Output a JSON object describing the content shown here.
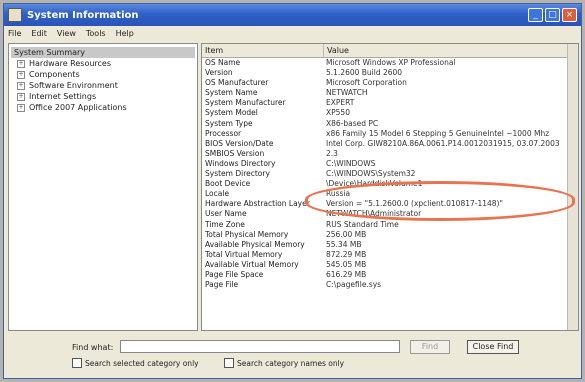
{
  "window": {
    "title": "System Information"
  },
  "menu": [
    "File",
    "Edit",
    "View",
    "Tools",
    "Help"
  ],
  "tree": {
    "root": "System Summary",
    "children": [
      "Hardware Resources",
      "Components",
      "Software Environment",
      "Internet Settings",
      "Office 2007 Applications"
    ]
  },
  "columns": {
    "item": "Item",
    "value": "Value"
  },
  "rows": [
    {
      "item": "OS Name",
      "value": "Microsoft Windows XP Professional"
    },
    {
      "item": "Version",
      "value": "5.1.2600 Build 2600"
    },
    {
      "item": "OS Manufacturer",
      "value": "Microsoft Corporation"
    },
    {
      "item": "System Name",
      "value": "NETWATCH"
    },
    {
      "item": "System Manufacturer",
      "value": "EXPERT"
    },
    {
      "item": "System Model",
      "value": "XP550"
    },
    {
      "item": "System Type",
      "value": "X86-based PC"
    },
    {
      "item": "Processor",
      "value": "x86 Family 15 Model 6 Stepping 5 GenuineIntel ~1000 Mhz"
    },
    {
      "item": "BIOS Version/Date",
      "value": "Intel Corp. GIW8210A.86A.0061.P14.0012031915, 03.07.2003"
    },
    {
      "item": "SMBIOS Version",
      "value": "2.3"
    },
    {
      "item": "Windows Directory",
      "value": "C:\\WINDOWS"
    },
    {
      "item": "System Directory",
      "value": "C:\\WINDOWS\\System32"
    },
    {
      "item": "Boot Device",
      "value": "\\Device\\HarddiskVolume1"
    },
    {
      "item": "Locale",
      "value": "Russia"
    },
    {
      "item": "Hardware Abstraction Layer",
      "value": "Version = \"5.1.2600.0 (xpclient.010817-1148)\""
    },
    {
      "item": "User Name",
      "value": "NETWATCH\\Administrator"
    },
    {
      "item": "Time Zone",
      "value": "RUS Standard Time"
    },
    {
      "item": "Total Physical Memory",
      "value": "256.00 MB"
    },
    {
      "item": "Available Physical Memory",
      "value": "55.34 MB"
    },
    {
      "item": "Total Virtual Memory",
      "value": "872.29 MB"
    },
    {
      "item": "Available Virtual Memory",
      "value": "545.05 MB"
    },
    {
      "item": "Page File Space",
      "value": "616.29 MB"
    },
    {
      "item": "Page File",
      "value": "C:\\pagefile.sys"
    }
  ],
  "find": {
    "label": "Find what:",
    "find_button": "Find",
    "close_button": "Close Find",
    "check1": "Search selected category only",
    "check2": "Search category names only"
  }
}
